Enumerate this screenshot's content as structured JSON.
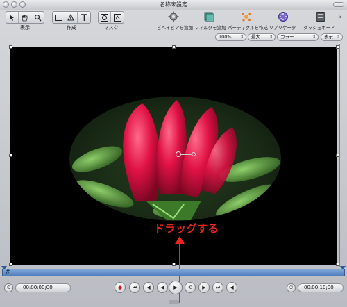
{
  "window": {
    "title": "名称未設定"
  },
  "toolbar": {
    "group_view": {
      "label": "表示",
      "icons": [
        "arrow-pointer-icon",
        "hand-icon",
        "zoom-icon"
      ]
    },
    "group_create": {
      "label": "作成",
      "icons": [
        "rectangle-icon",
        "bezier-pen-icon",
        "text-icon"
      ]
    },
    "group_mask": {
      "label": "マスク",
      "icons": [
        "circle-mask-icon",
        "bezier-mask-icon"
      ]
    },
    "add_behavior": "ビヘイビアを追加",
    "add_filter": "フィルタを追加",
    "make_particles": "パーティクルを作成",
    "replicator": "リプリケータ",
    "dashboard": "ダッシュボード"
  },
  "options": {
    "zoom": "100%",
    "quality": "最大",
    "color": "カラー",
    "view": "表示"
  },
  "canvas": {
    "callout_text": "ドラッグする",
    "callout_color": "#e8251f"
  },
  "timeline": {
    "track_label": "花"
  },
  "transport": {
    "current_time": "00:00:00;00",
    "end_time": "00:00:10;00"
  },
  "colors": {
    "timeline": "#4f7fbf",
    "canvas": "#000000"
  }
}
